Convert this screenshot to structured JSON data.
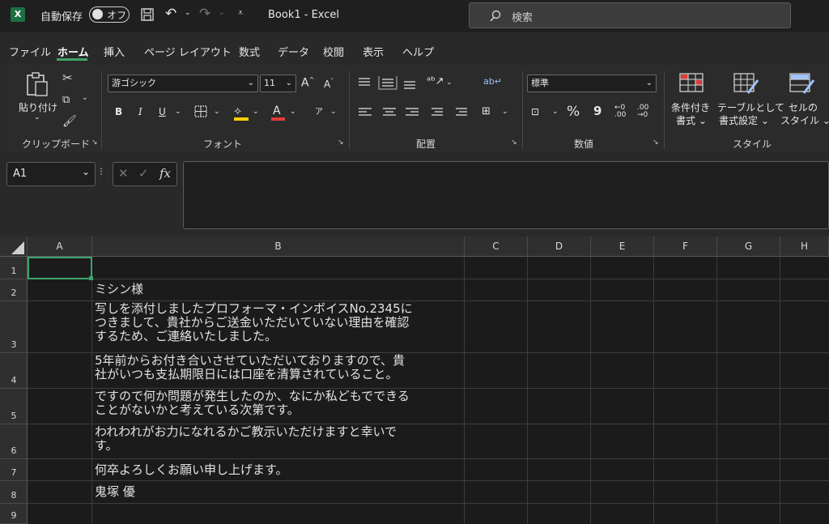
{
  "titlebar": {
    "excel_logo": "X",
    "autosave_label": "自動保存",
    "autosave_state": "オフ",
    "file_title": "Book1  -  Excel",
    "search_placeholder": "検索"
  },
  "menu": {
    "items": [
      "ファイル",
      "ホーム",
      "挿入",
      "ページ レイアウト",
      "数式",
      "データ",
      "校閲",
      "表示",
      "ヘルプ"
    ],
    "active": "ホーム"
  },
  "ribbon": {
    "clipboard": {
      "paste_label": "貼り付け",
      "group_label": "クリップボード"
    },
    "font": {
      "font_name": "游ゴシック",
      "font_size": "11",
      "bold": "B",
      "italic": "I",
      "underline": "U",
      "group_label": "フォント",
      "grow": "A",
      "shrink": "A",
      "color_a": "A"
    },
    "alignment": {
      "group_label": "配置"
    },
    "number": {
      "format": "標準",
      "percent": "%",
      "comma": "9",
      "inc_decimal": "←0 .00",
      "dec_decimal": ".00 →0",
      "group_label": "数値"
    },
    "styles": {
      "cond_format": [
        "条件付き",
        "書式 ⌄"
      ],
      "table_format": [
        "テーブルとして",
        "書式設定 ⌄"
      ],
      "cell_styles": [
        "セルの",
        "スタイル ⌄"
      ],
      "group_label": "スタイル"
    }
  },
  "formula_bar": {
    "name_box": "A1",
    "fx": "fx"
  },
  "grid": {
    "columns": [
      "A",
      "B",
      "C",
      "D",
      "E",
      "F",
      "G",
      "H"
    ],
    "rows": [
      "1",
      "2",
      "3",
      "4",
      "5",
      "6",
      "7",
      "8",
      "9"
    ],
    "cells_B": [
      "",
      "ミシン様",
      "写しを添付しましたプロフォーマ・インボイスNo.2345に\nつきまして、貴社からご送金いただいていない理由を確認\nするため、ご連絡いたしました。",
      "5年前からお付き合いさせていただいておりますので、貴\n社がいつも支払期限日には口座を清算されていること。",
      "ですので何か問題が発生したのか、なにか私どもでできる\nことがないかと考えている次第です。",
      "われわれがお力になれるかご教示いただけますと幸いで\nす。",
      "何卒よろしくお願い申し上げます。",
      "鬼塚 優",
      ""
    ]
  },
  "colors": {
    "accent": "#3fa36b",
    "excel_green": "#1d6f42",
    "fill_yellow": "#f5d000",
    "font_red": "#e03b3b"
  }
}
